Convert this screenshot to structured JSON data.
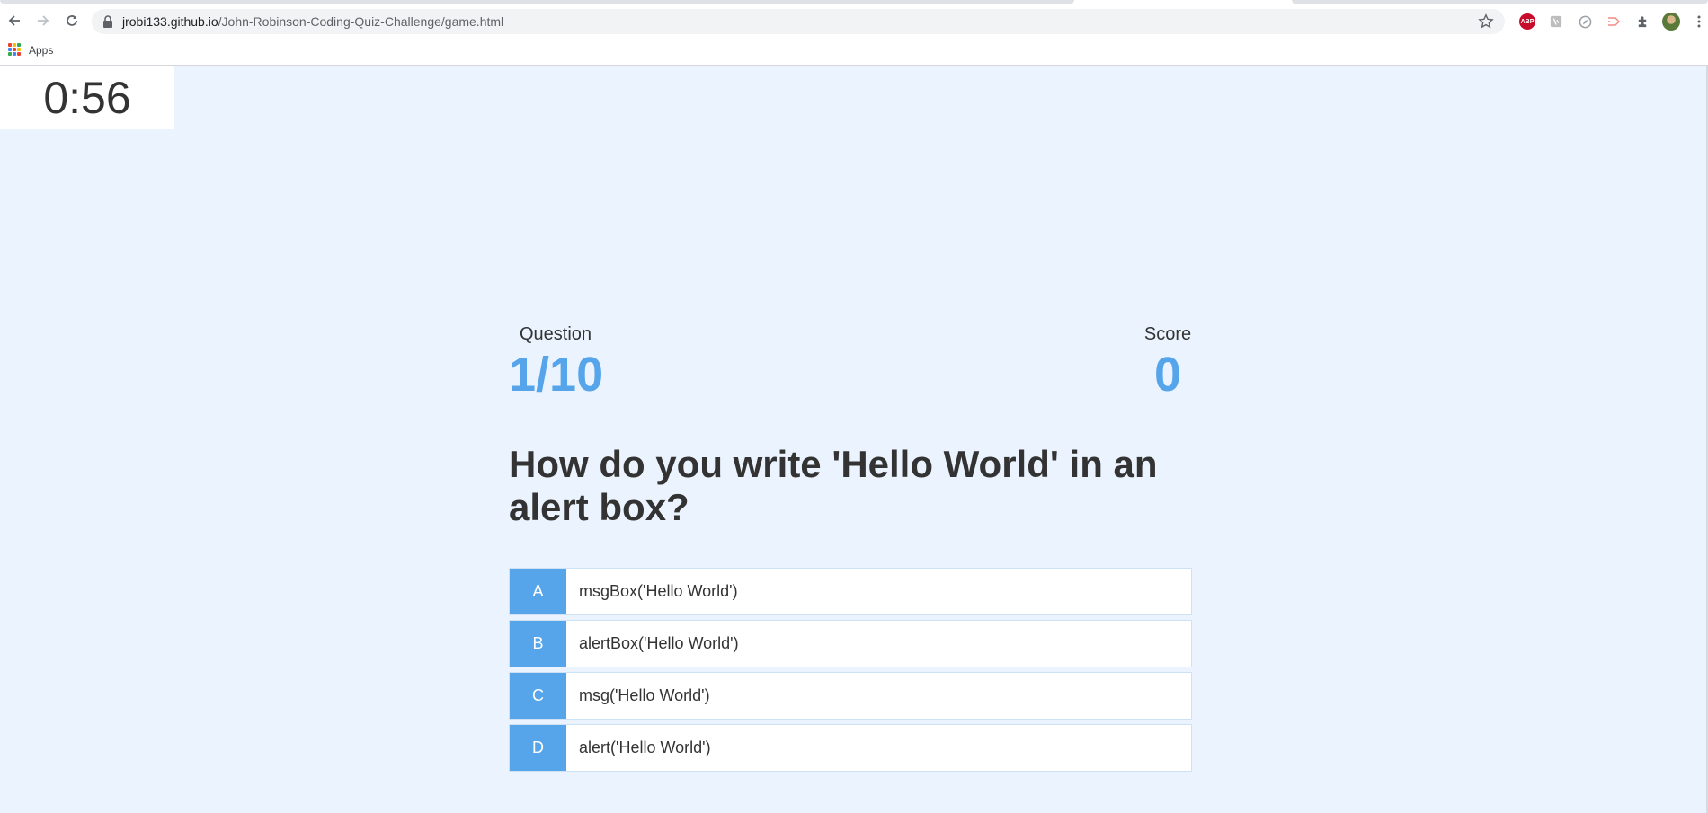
{
  "browser": {
    "url_host": "jrobi133.github.io",
    "url_path": "/John-Robinson-Coding-Quiz-Challenge/game.html",
    "bookmarks_apps_label": "Apps",
    "extensions": [
      "adblock-plus-icon",
      "extension-icon",
      "compass-icon",
      "cast-icon",
      "puzzle-icon",
      "profile-avatar"
    ]
  },
  "timer": {
    "value": "0:56"
  },
  "hud": {
    "question_label": "Question",
    "question_progress": "1/10",
    "score_label": "Score",
    "score_value": "0"
  },
  "question": {
    "text": "How do you write 'Hello World' in an alert box?"
  },
  "choices": [
    {
      "prefix": "A",
      "text": "msgBox('Hello World')"
    },
    {
      "prefix": "B",
      "text": "alertBox('Hello World')"
    },
    {
      "prefix": "C",
      "text": "msg('Hello World')"
    },
    {
      "prefix": "D",
      "text": "alert('Hello World')"
    }
  ],
  "colors": {
    "accent": "#56a5eb",
    "page_background": "#ebf4fe",
    "text": "#333333"
  }
}
